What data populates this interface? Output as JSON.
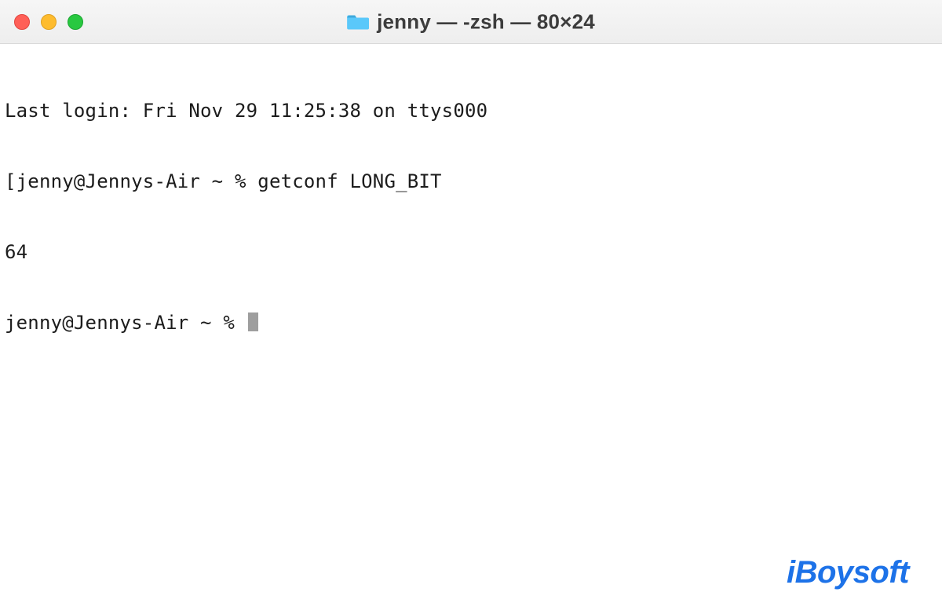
{
  "titlebar": {
    "title": "jenny — -zsh — 80×24",
    "folder_icon": "folder-icon"
  },
  "terminal": {
    "last_login": "Last login: Fri Nov 29 11:25:38 on ttys000",
    "prompt1_prefix": "[jenny@Jennys-Air ~ % ",
    "command1": "getconf LONG_BIT",
    "output1": "64",
    "prompt2": "jenny@Jennys-Air ~ % "
  },
  "watermark": {
    "text": "iBoysoft"
  }
}
